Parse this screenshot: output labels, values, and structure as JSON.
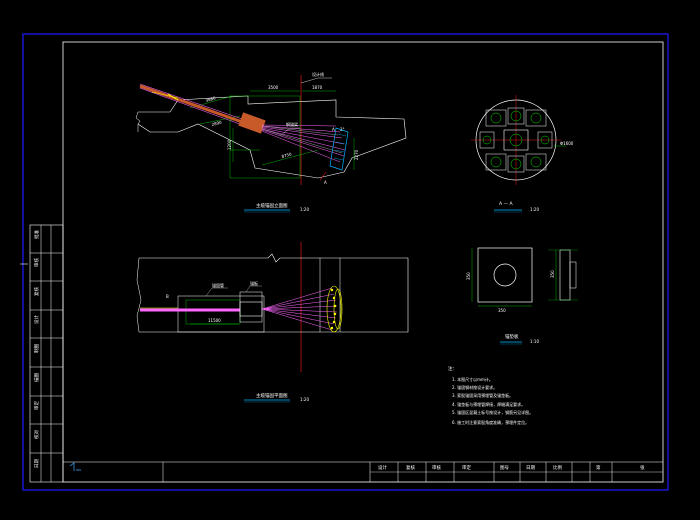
{
  "views": {
    "elevation": {
      "title": "主缆锚固立面图",
      "scale": "1:20"
    },
    "plan": {
      "title": "主缆锚固平面图",
      "scale": "1:20"
    },
    "section": {
      "title": "A — A",
      "scale": "1:20"
    },
    "plate": {
      "title": "锚垫板",
      "scale": "1:10"
    }
  },
  "dims": {
    "el_top_1": "3500",
    "el_top_2": "1870",
    "el_diag_1": "3880",
    "el_diag_2": "2890",
    "el_vert_1": "1200",
    "el_vert_2": "2270",
    "el_len": "8750",
    "el_angle": "2°",
    "sec_r": "Φ1600",
    "plan_len": "11500",
    "plate_w": "350",
    "plate_h": "350",
    "plate_side": "350"
  },
  "notes": {
    "heading": "注：",
    "items": [
      "1. 本图尺寸以mm计。",
      "2. 锚固钢材按设计要求。",
      "3. 索股锚固采用预埋管及锚垫板。",
      "4. 锚垫板与预埋管焊接，焊缝满足要求。",
      "5. 锚固区混凝土标号按设计，钢筋另见详图。",
      "6. 施工时注意索股角度准确，预埋件定位。"
    ]
  },
  "side_strip": [
    "批准",
    "审核",
    "复核",
    "设计",
    "制图",
    "描图",
    "审定",
    "校对",
    "日期"
  ],
  "title_block": {
    "cells": [
      "设计",
      "复核",
      "审核",
      "审定",
      "图号",
      "日期",
      "比例",
      "第",
      "张"
    ]
  },
  "colors": {
    "frame": "#1a1aff",
    "outline": "#ffffff",
    "dimension": "#00e000",
    "centerline": "#e01818",
    "cable": "#ff66ff",
    "anchor": "#c85a2a",
    "hatch": "#00b4ff",
    "yellow": "#ffff00"
  }
}
